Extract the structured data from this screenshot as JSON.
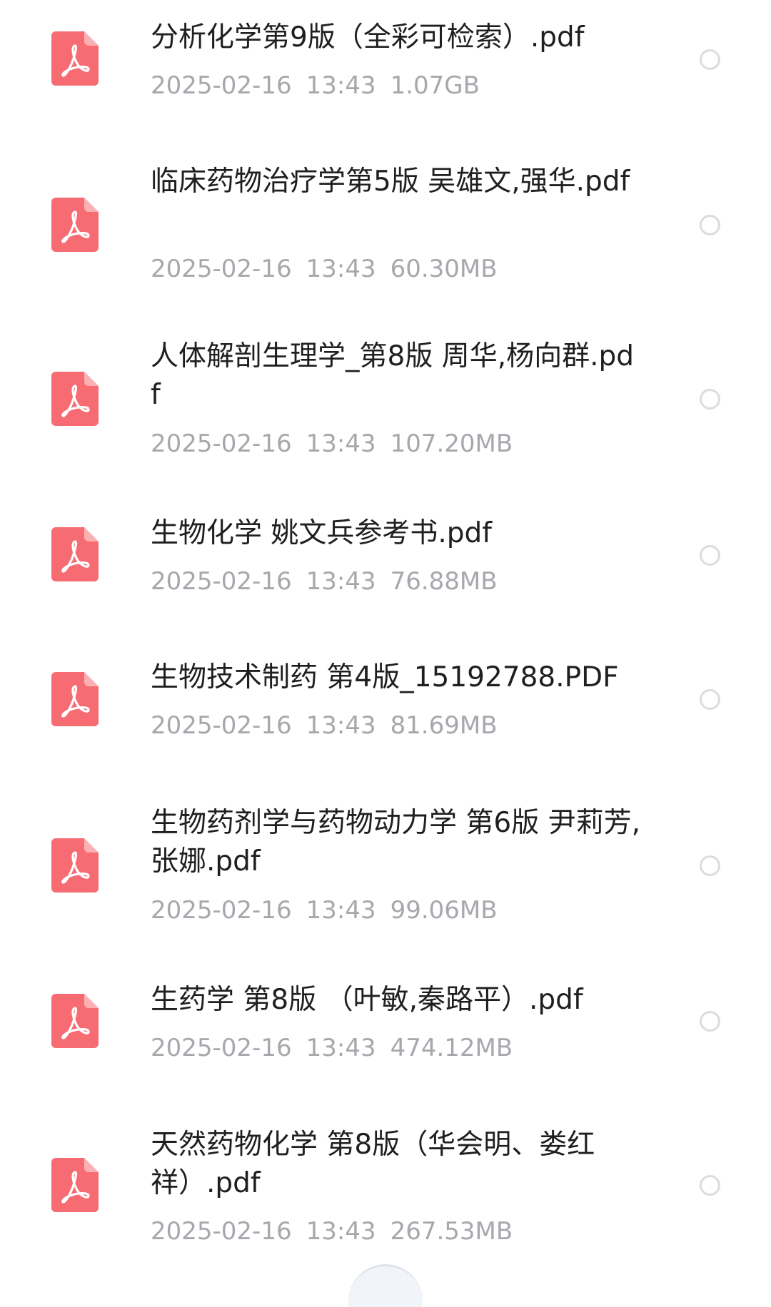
{
  "icons": {
    "file_icon": "pdf-file-icon",
    "select_icon": "radio-unchecked-icon"
  },
  "colors": {
    "pdf_icon": "#f76c72",
    "title": "#1f1f1f",
    "meta": "#a7a7ad",
    "radio": "#dcdcdc"
  },
  "files": [
    {
      "name": "分析化学第9版（全彩可检索）.pdf",
      "date": "2025-02-16",
      "time": "13:43",
      "size": "1.07GB"
    },
    {
      "name": "临床药物治疗学第5版 吴雄文,强华.pdf",
      "date": "2025-02-16",
      "time": "13:43",
      "size": "60.30MB"
    },
    {
      "name": "人体解剖生理学_第8版 周华,杨向群.pdf",
      "date": "2025-02-16",
      "time": "13:43",
      "size": "107.20MB"
    },
    {
      "name": "生物化学 姚文兵参考书.pdf",
      "date": "2025-02-16",
      "time": "13:43",
      "size": "76.88MB"
    },
    {
      "name": "生物技术制药  第4版_15192788.PDF",
      "date": "2025-02-16",
      "time": "13:43",
      "size": "81.69MB"
    },
    {
      "name": "生物药剂学与药物动力学 第6版 尹莉芳,张娜.pdf",
      "date": "2025-02-16",
      "time": "13:43",
      "size": "99.06MB"
    },
    {
      "name": "生药学 第8版 （叶敏,秦路平）.pdf",
      "date": "2025-02-16",
      "time": "13:43",
      "size": "474.12MB"
    },
    {
      "name": "天然药物化学 第8版（华会明、娄红祥）.pdf",
      "date": "2025-02-16",
      "time": "13:43",
      "size": "267.53MB"
    }
  ]
}
